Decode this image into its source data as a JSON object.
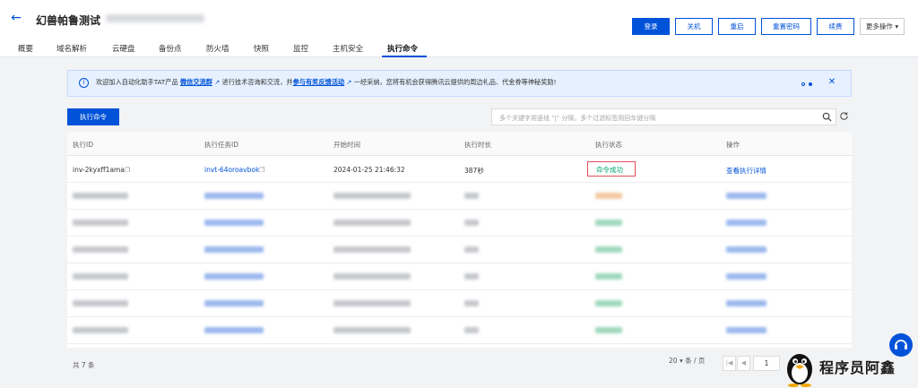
{
  "header": {
    "title": "幻兽帕鲁测试",
    "actions": [
      "登录",
      "关机",
      "重启",
      "重置密码",
      "续费",
      "更多操作"
    ]
  },
  "tabs": [
    "概要",
    "域名解析",
    "云硬盘",
    "备份点",
    "防火墙",
    "快照",
    "监控",
    "主机安全",
    "执行命令"
  ],
  "active_tab": "执行命令",
  "banner": {
    "part1": "欢迎加入自动化助手TAT产品",
    "link1": "微信交流群",
    "part2": "进行技术咨询和交流，并",
    "link2": "参与有奖反馈活动",
    "part3": "一经采纳，您将有机会获得腾讯云提供的周边礼品、代金券等神秘奖励!"
  },
  "toolbar": {
    "run_label": "执行命令",
    "search_placeholder": "多个关键字用竖线 \"|\" 分隔，多个过滤标签用回车键分隔"
  },
  "table": {
    "columns": [
      "执行ID",
      "执行任务ID",
      "开始时间",
      "执行时长",
      "执行状态",
      "操作"
    ],
    "first_row": {
      "exec_id": "inv-2kyxff1ama",
      "task_id": "invt-64oroavbok",
      "start_time": "2024-01-25 21:46:32",
      "duration": "387秒",
      "status": "命令成功",
      "action": "查看执行详情"
    }
  },
  "footer": {
    "total": "共 7 条",
    "page_size": "20",
    "page_size_unit": "条 / 页",
    "current_page": "1"
  },
  "watermark": {
    "text": "程序员阿鑫"
  },
  "colors": {
    "primary": "#0052d9",
    "success": "#00a870",
    "highlight": "#e34d59"
  }
}
